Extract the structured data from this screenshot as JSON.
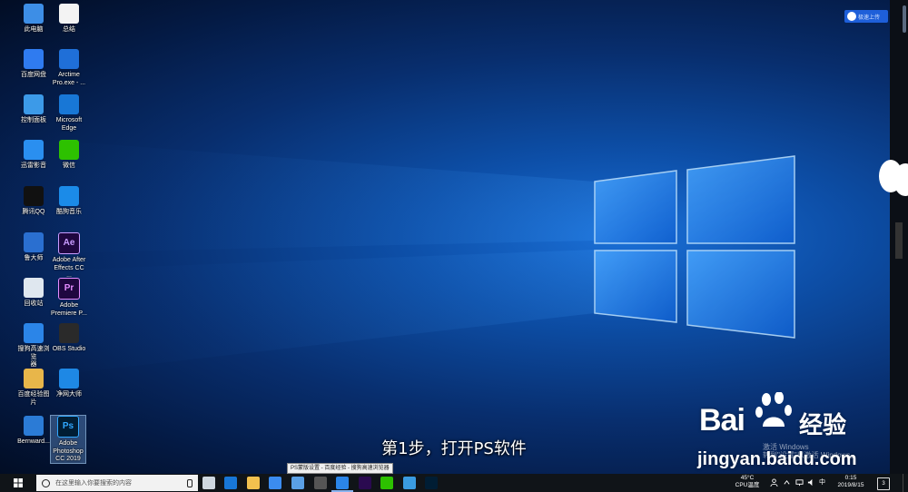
{
  "desktop_icons": [
    {
      "label": "此电脑",
      "icon": "computer-icon",
      "color": "#3d8ee6"
    },
    {
      "label": "总结",
      "icon": "document-icon",
      "color": "#f3f3f3"
    },
    {
      "label": "百度网盘",
      "icon": "baidu-netdisk-icon",
      "color": "#2f7bf0"
    },
    {
      "label": "Arctime\nPro.exe - ...",
      "icon": "arctime-icon",
      "color": "#1f6fd8"
    },
    {
      "label": "控制面板",
      "icon": "control-panel-icon",
      "color": "#3c9ae8"
    },
    {
      "label": "Microsoft\nEdge",
      "icon": "edge-icon",
      "color": "#1877d6"
    },
    {
      "label": "迅雷影音",
      "icon": "xunlei-player-icon",
      "color": "#2a8ff0"
    },
    {
      "label": "微信",
      "icon": "wechat-icon",
      "color": "#2dc100"
    },
    {
      "label": "腾讯QQ",
      "icon": "qq-icon",
      "color": "#111111"
    },
    {
      "label": "酷狗音乐",
      "icon": "kugou-icon",
      "color": "#1b8be8"
    },
    {
      "label": "鲁大师",
      "icon": "ludashi-icon",
      "color": "#2a6fd0"
    },
    {
      "label": "Adobe After\nEffects CC ...",
      "icon": "after-effects-icon",
      "color": "#1f0740",
      "text": "Ae",
      "text_color": "#c99cff"
    },
    {
      "label": "回收站",
      "icon": "recycle-bin-icon",
      "color": "#dfe7ef"
    },
    {
      "label": "Adobe\nPremiere P...",
      "icon": "premiere-icon",
      "color": "#1f0740",
      "text": "Pr",
      "text_color": "#e58cff"
    },
    {
      "label": "搜狗高速浏览\n器",
      "icon": "sogou-browser-icon",
      "color": "#2b85e8"
    },
    {
      "label": "OBS Studio",
      "icon": "obs-icon",
      "color": "#2a2a2a"
    },
    {
      "label": "百度经验图片",
      "icon": "folder-icon",
      "color": "#e8b64a"
    },
    {
      "label": "净网大师",
      "icon": "adsafe-icon",
      "color": "#1e88e5"
    },
    {
      "label": "Bernward...",
      "icon": "bernward-icon",
      "color": "#2b7bd6"
    },
    {
      "label": "Adobe\nPhotoshop\nCC 2019",
      "icon": "photoshop-icon",
      "color": "#001d34",
      "text": "Ps",
      "text_color": "#31a8ff"
    }
  ],
  "upload_widget": {
    "label": "极速上传"
  },
  "subtitle": "第1步，打开PS软件",
  "watermark": {
    "brand": "Bai",
    "suffix": "经验",
    "url": "jingyan.baidu.com"
  },
  "activate_windows": {
    "line1": "激活 Windows",
    "line2": "转到\"设置\"以激活 Windows。"
  },
  "taskbar": {
    "search_placeholder": "在这里输入你要搜索的内容",
    "tooltip": "PS蒙版设置 - 百度经验 - 搜狗高速浏览器",
    "apps": [
      {
        "name": "task-view-icon",
        "color": "#cfd8e0"
      },
      {
        "name": "edge-taskbar-icon",
        "color": "#1877d6"
      },
      {
        "name": "file-explorer-taskbar-icon",
        "color": "#f2c14e"
      },
      {
        "name": "baidu-netdisk-taskbar-icon",
        "color": "#3b8cf0"
      },
      {
        "name": "notepad-taskbar-icon",
        "color": "#5aa0e6"
      },
      {
        "name": "obs-taskbar-icon",
        "color": "#555555"
      },
      {
        "name": "sogou-browser-taskbar-icon",
        "color": "#2b85e8"
      },
      {
        "name": "premiere-taskbar-icon",
        "color": "#2a0a50"
      },
      {
        "name": "wechat-taskbar-icon",
        "color": "#2dc100"
      },
      {
        "name": "media-taskbar-icon",
        "color": "#3a9be0"
      },
      {
        "name": "photoshop-taskbar-icon",
        "color": "#001d34"
      }
    ],
    "temperature": "45°C",
    "temperature_label": "CPU温度",
    "time": "0:15",
    "date": "2019/8/15",
    "notification_count": "3"
  }
}
